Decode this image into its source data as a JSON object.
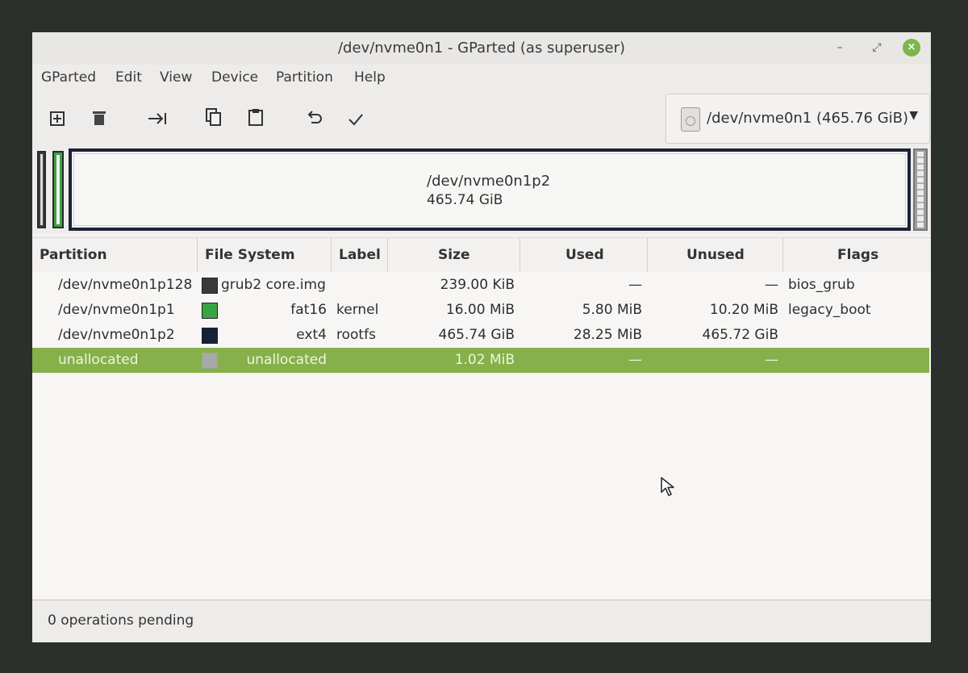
{
  "window": {
    "title": "/dev/nvme0n1 - GParted (as superuser)",
    "controls": {
      "minimize": "–",
      "maximize": "⤢",
      "close": "×"
    }
  },
  "menu": [
    "GParted",
    "Edit",
    "View",
    "Device",
    "Partition",
    "Help"
  ],
  "toolbar": {
    "icons": [
      "new-icon",
      "delete-icon",
      "resize-move-icon",
      "copy-icon",
      "paste-icon",
      "undo-icon",
      "apply-icon"
    ],
    "device_selector": "/dev/nvme0n1 (465.76 GiB)"
  },
  "graph": {
    "main_partition_name": "/dev/nvme0n1p2",
    "main_partition_size": "465.74 GiB"
  },
  "table": {
    "columns": [
      "Partition",
      "File System",
      "Label",
      "Size",
      "Used",
      "Unused",
      "Flags"
    ],
    "rows": [
      {
        "partition": "/dev/nvme0n1p128",
        "fs": "grub2 core.img",
        "fs_color": "#3a3a3a",
        "label": "",
        "size": "239.00 KiB",
        "used": "—",
        "unused": "—",
        "flags": "bios_grub"
      },
      {
        "partition": "/dev/nvme0n1p1",
        "fs": "fat16",
        "fs_color": "#3aa444",
        "label": "kernel",
        "size": "16.00 MiB",
        "used": "5.80 MiB",
        "unused": "10.20 MiB",
        "flags": "legacy_boot"
      },
      {
        "partition": "/dev/nvme0n1p2",
        "fs": "ext4",
        "fs_color": "#15223a",
        "label": "rootfs",
        "size": "465.74 GiB",
        "used": "28.25 MiB",
        "unused": "465.72 GiB",
        "flags": ""
      },
      {
        "partition": "unallocated",
        "fs": "unallocated",
        "fs_color": "#a8a8a8",
        "label": "",
        "size": "1.02 MiB",
        "used": "—",
        "unused": "—",
        "flags": "",
        "selected": true
      }
    ]
  },
  "status": "0 operations pending",
  "colors": {
    "selection": "#86b04a",
    "accent": "#7db64b"
  }
}
